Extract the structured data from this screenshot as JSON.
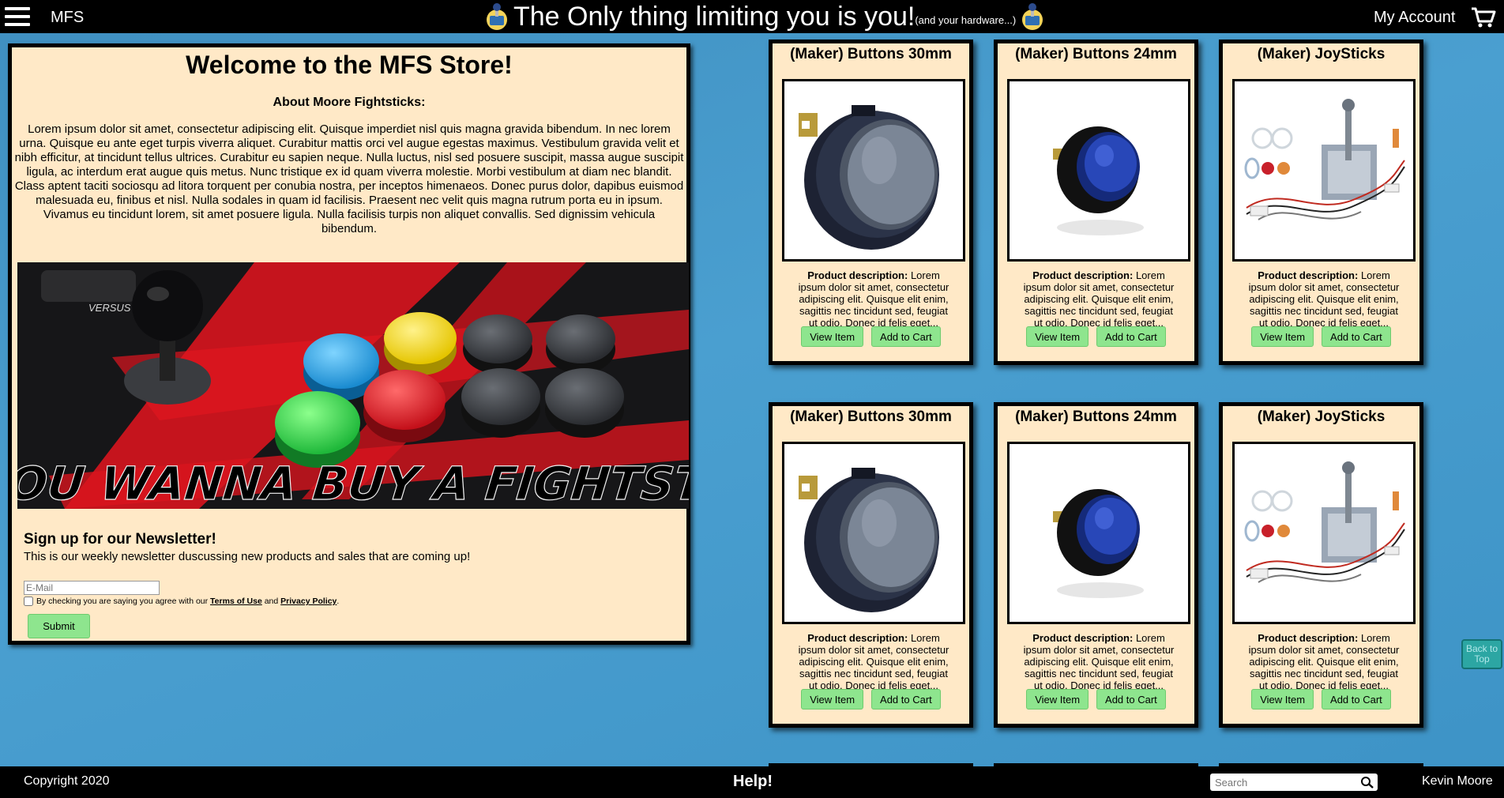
{
  "header": {
    "brand": "MFS",
    "tagline_main": "The Only thing limiting you is you!",
    "tagline_small": "(and your hardware...)",
    "account_label": "My Account"
  },
  "welcome": {
    "title": "Welcome to the MFS Store!",
    "subtitle": "About Moore Fightsticks:",
    "paragraph1": "Lorem ipsum dolor sit amet, consectetur adipiscing elit. Quisque imperdiet nisl quis magna gravida bibendum. In nec lorem urna. Quisque eu ante eget turpis viverra aliquet. Curabitur mattis orci vel augue egestas maximus. Vestibulum gravida velit et nibh efficitur, at tincidunt tellus ultrices. Curabitur eu sapien neque. Nulla luctus, nisl sed posuere suscipit, massa augue suscipit ligula, ac interdum erat augue quis metus. Nunc tristique ex id quam viverra molestie. Morbi vestibulum at diam nec blandit.",
    "paragraph2": "Class aptent taciti sociosqu ad litora torquent per conubia nostra, per inceptos himenaeos. Donec purus dolor, dapibus euismod malesuada eu, finibus et nisl. Nulla sodales in quam id facilisis. Praesent nec velit quis magna rutrum porta eu in ipsum. Vivamus eu tincidunt lorem, sit amet posuere ligula. Nulla facilisis turpis non aliquet convallis. Sed dignissim vehicula bibendum.",
    "banner_text": "SO YOU WANNA BUY A FIGHTSTICK?",
    "banner_label": "VERSUS"
  },
  "newsletter": {
    "title": "Sign up for our Newsletter!",
    "subtitle": "This is our weekly newsletter duscussing new products and sales that are coming up!",
    "email_placeholder": "E-Mail",
    "agree_prefix": "By checking you are saying you agree with our ",
    "terms_label": "Terms of Use",
    "agree_and": " and ",
    "privacy_label": "Privacy Policy",
    "agree_suffix": ".",
    "submit_label": "Submit"
  },
  "products": [
    {
      "title": "(Maker) Buttons 30mm",
      "image": "button-30mm",
      "desc_label": "Product description:",
      "desc": " Lorem ipsum dolor sit amet, consectetur adipiscing elit. Quisque elit enim, sagittis nec tincidunt sed, feugiat ut odio. Donec id felis eget...",
      "view_label": "View Item",
      "cart_label": "Add to Cart"
    },
    {
      "title": "(Maker) Buttons 24mm",
      "image": "button-24mm",
      "desc_label": "Product description:",
      "desc": " Lorem ipsum dolor sit amet, consectetur adipiscing elit. Quisque elit enim, sagittis nec tincidunt sed, feugiat ut odio. Donec id felis eget...",
      "view_label": "View Item",
      "cart_label": "Add to Cart"
    },
    {
      "title": "(Maker) JoySticks",
      "image": "joystick",
      "desc_label": "Product description:",
      "desc": " Lorem ipsum dolor sit amet, consectetur adipiscing elit. Quisque elit enim, sagittis nec tincidunt sed, feugiat ut odio. Donec id felis eget...",
      "view_label": "View Item",
      "cart_label": "Add to Cart"
    },
    {
      "title": "(Maker) Buttons 30mm",
      "image": "button-30mm",
      "desc_label": "Product description:",
      "desc": " Lorem ipsum dolor sit amet, consectetur adipiscing elit. Quisque elit enim, sagittis nec tincidunt sed, feugiat ut odio. Donec id felis eget...",
      "view_label": "View Item",
      "cart_label": "Add to Cart"
    },
    {
      "title": "(Maker) Buttons 24mm",
      "image": "button-24mm",
      "desc_label": "Product description:",
      "desc": " Lorem ipsum dolor sit amet, consectetur adipiscing elit. Quisque elit enim, sagittis nec tincidunt sed, feugiat ut odio. Donec id felis eget...",
      "view_label": "View Item",
      "cart_label": "Add to Cart"
    },
    {
      "title": "(Maker) JoySticks",
      "image": "joystick",
      "desc_label": "Product description:",
      "desc": " Lorem ipsum dolor sit amet, consectetur adipiscing elit. Quisque elit enim, sagittis nec tincidunt sed, feugiat ut odio. Donec id felis eget...",
      "view_label": "View Item",
      "cart_label": "Add to Cart"
    }
  ],
  "back_to_top": {
    "line1": "Back to",
    "line2": "Top"
  },
  "footer": {
    "copyright": "Copyright 2020",
    "help": "Help!",
    "search_placeholder": "Search",
    "user": "Kevin Moore"
  },
  "icons": {
    "menu": "hamburger-menu-icon",
    "cart": "shopping-cart-icon",
    "joystick": "joystick-icon",
    "search": "magnifier-icon"
  },
  "colors": {
    "background": "#4a9fd0",
    "panel": "#ffe9c7",
    "button_green": "#8ee58e",
    "bar": "#000000"
  }
}
